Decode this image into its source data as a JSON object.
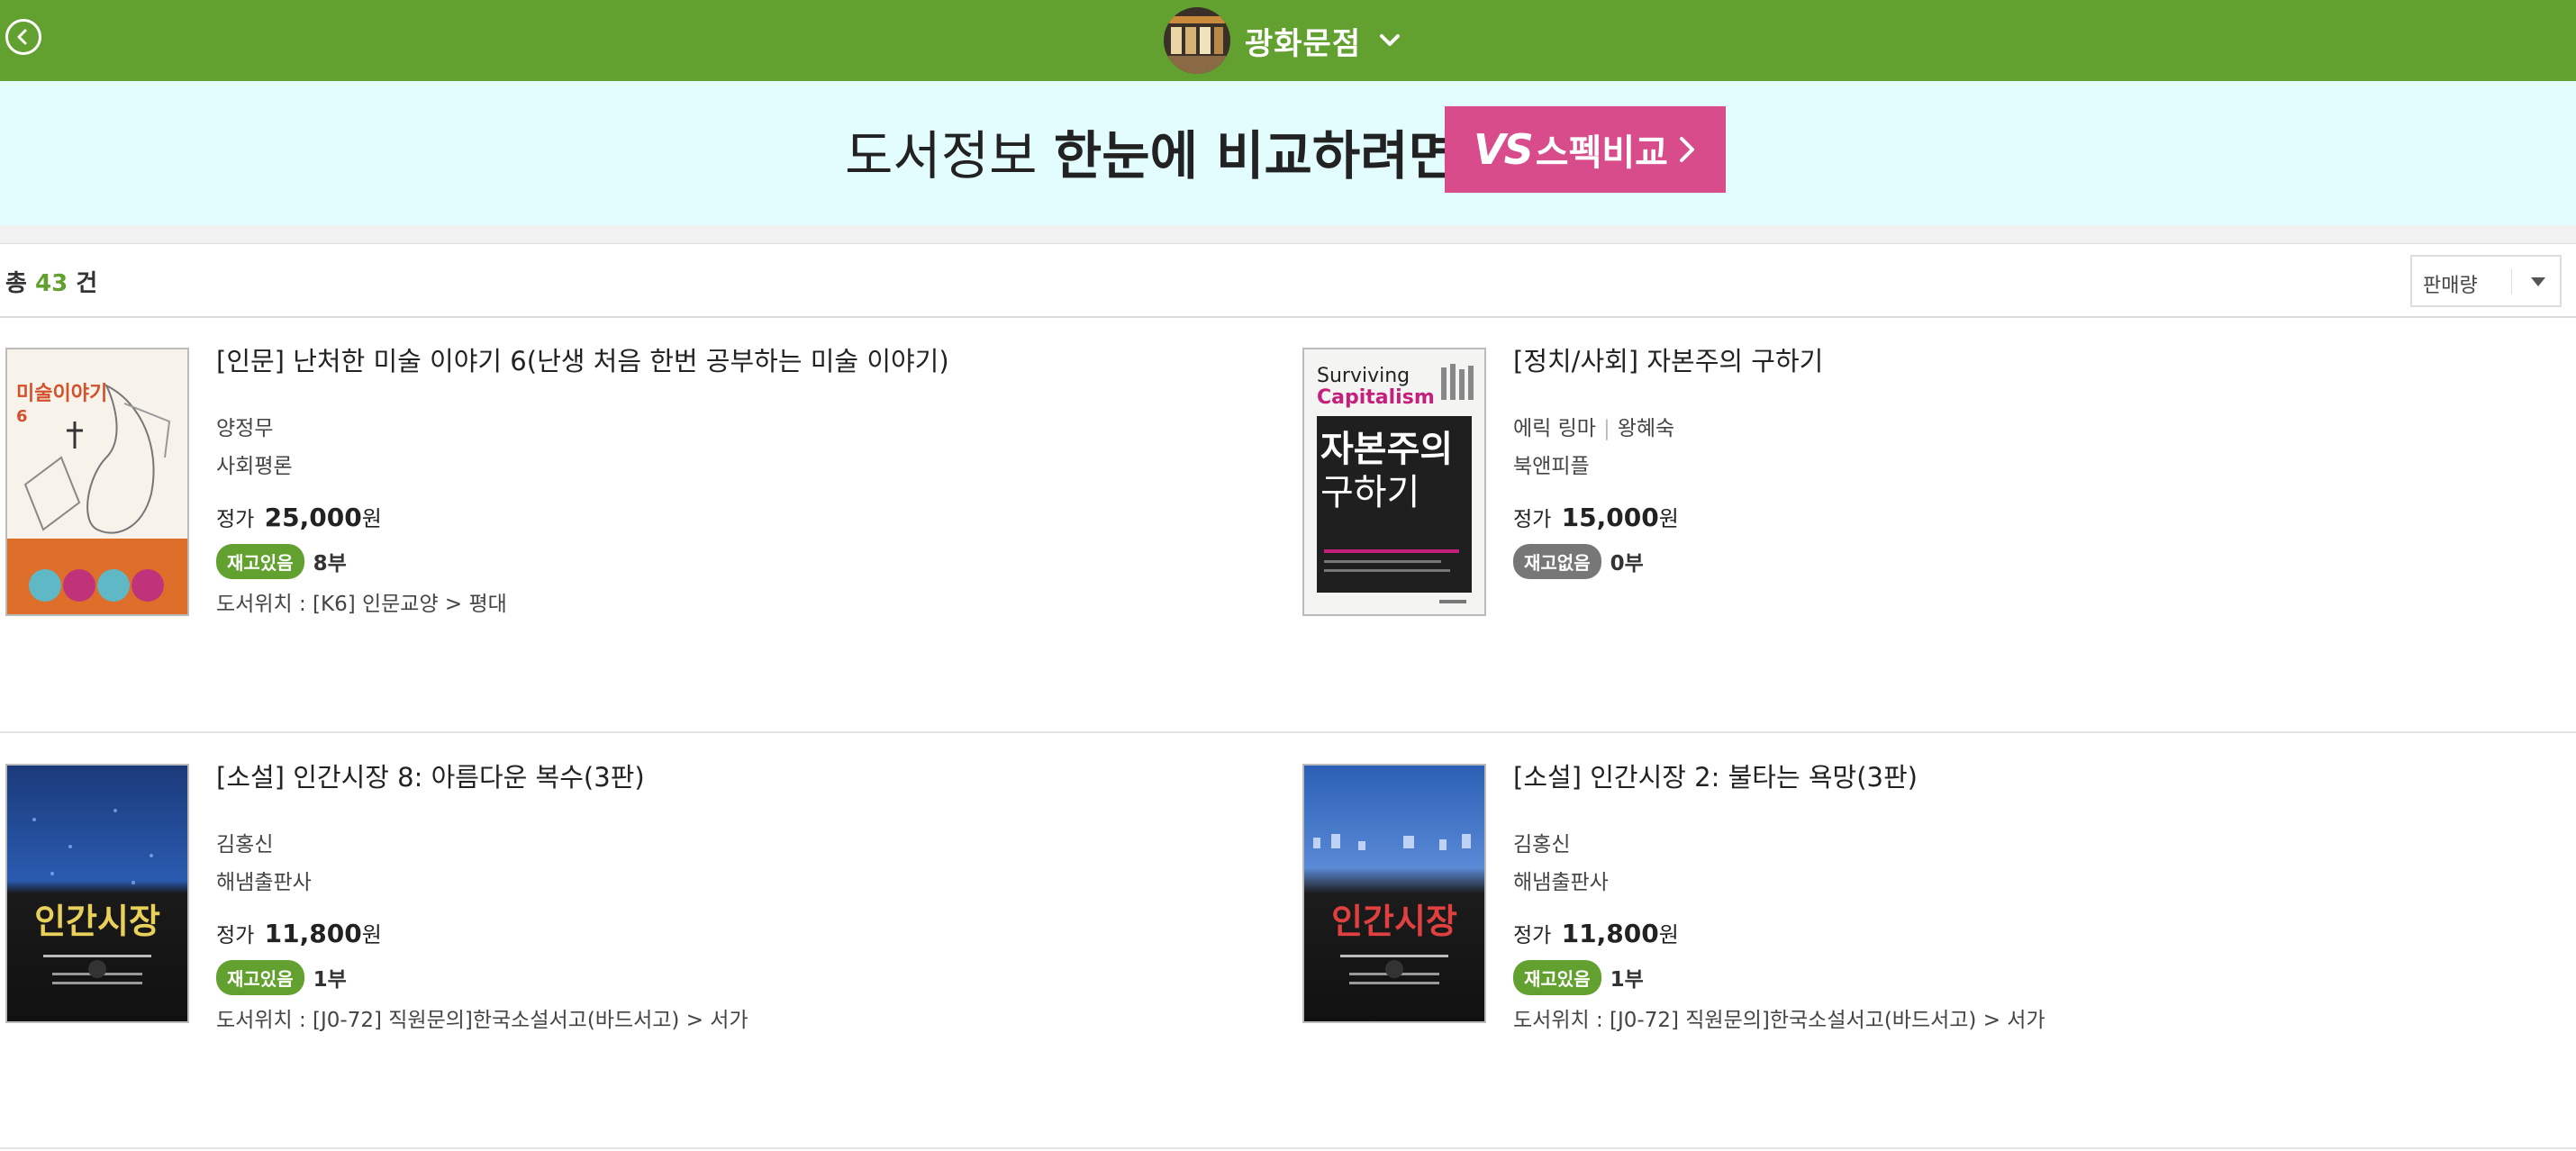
{
  "header": {
    "store_name": "광화문점",
    "back_icon": "chevron-left-icon",
    "dropdown_icon": "chevron-down-icon",
    "bar_color": "#62a12f"
  },
  "banner": {
    "text_light": "도서정보",
    "text_bold": "한눈에 비교하려면",
    "button_logo": "VS",
    "button_label": "스펙비교",
    "button_color": "#d84c8c",
    "background": "#e3fcfd"
  },
  "results": {
    "prefix": "총",
    "count": "43",
    "suffix": "건",
    "sort_label": "판매량"
  },
  "items": [
    {
      "title": "[인문] 난처한 미술 이야기 6(난생 처음 한번 공부하는 미술 이야기)",
      "author": "양정무",
      "translator": "",
      "publisher": "사회평론",
      "price_label": "정가",
      "price": "25,000",
      "currency": "원",
      "stock_status": "재고있음",
      "stock_qty": "8부",
      "location": "도서위치 : [K6] 인문교양 > 평대",
      "cover_title": "미술이야기",
      "cover_number": "6"
    },
    {
      "title": "[정치/사회] 자본주의 구하기",
      "author": "에릭 링마",
      "translator": "왕혜숙",
      "publisher": "북앤피플",
      "price_label": "정가",
      "price": "15,000",
      "currency": "원",
      "stock_status": "재고없음",
      "stock_qty": "0부",
      "location": "",
      "cover_title_en1": "Surviving",
      "cover_title_en2": "Capitalism",
      "cover_title_ko1": "자본주의",
      "cover_title_ko2": "구하기"
    },
    {
      "title": "[소설] 인간시장 8: 아름다운 복수(3판)",
      "author": "김홍신",
      "translator": "",
      "publisher": "해냄출판사",
      "price_label": "정가",
      "price": "11,800",
      "currency": "원",
      "stock_status": "재고있음",
      "stock_qty": "1부",
      "location": "도서위치 : [J0-72] 직원문의]한국소설서고(바드서고) > 서가",
      "cover_title": "인간시장"
    },
    {
      "title": "[소설] 인간시장 2: 불타는 욕망(3판)",
      "author": "김홍신",
      "translator": "",
      "publisher": "해냄출판사",
      "price_label": "정가",
      "price": "11,800",
      "currency": "원",
      "stock_status": "재고있음",
      "stock_qty": "1부",
      "location": "도서위치 : [J0-72] 직원문의]한국소설서고(바드서고) > 서가",
      "cover_title": "인간시장"
    }
  ]
}
